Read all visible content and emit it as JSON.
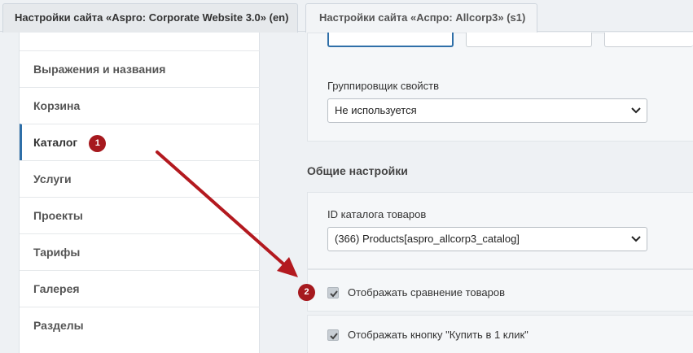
{
  "tabs": [
    {
      "label": "Настройки сайта «Aspro: Corporate Website 3.0» (en)",
      "active": true
    },
    {
      "label": "Настройки сайта «Аспро: Allcorp3» (s1)",
      "active": false
    }
  ],
  "sidebar": {
    "items": [
      {
        "label": "Выражения и названия"
      },
      {
        "label": "Корзина"
      },
      {
        "label": "Каталог",
        "badge": "1",
        "active": true
      },
      {
        "label": "Услуги"
      },
      {
        "label": "Проекты"
      },
      {
        "label": "Тарифы"
      },
      {
        "label": "Галерея"
      },
      {
        "label": "Разделы"
      }
    ]
  },
  "main": {
    "grouper": {
      "label": "Группировщик свойств",
      "value": "Не используется"
    },
    "section_title": "Общие настройки",
    "catalog_id": {
      "label": "ID каталога товаров",
      "value": "(366) Products[aspro_allcorp3_catalog]"
    },
    "checkboxes": [
      {
        "label": "Отображать сравнение товаров",
        "checked": true,
        "badge": "2"
      },
      {
        "label": "Отображать кнопку \"Купить в 1 клик\"",
        "checked": true
      }
    ]
  },
  "colors": {
    "badge": "#a6191e",
    "arrow": "#b3191f",
    "active_border": "#2f6fa8"
  }
}
